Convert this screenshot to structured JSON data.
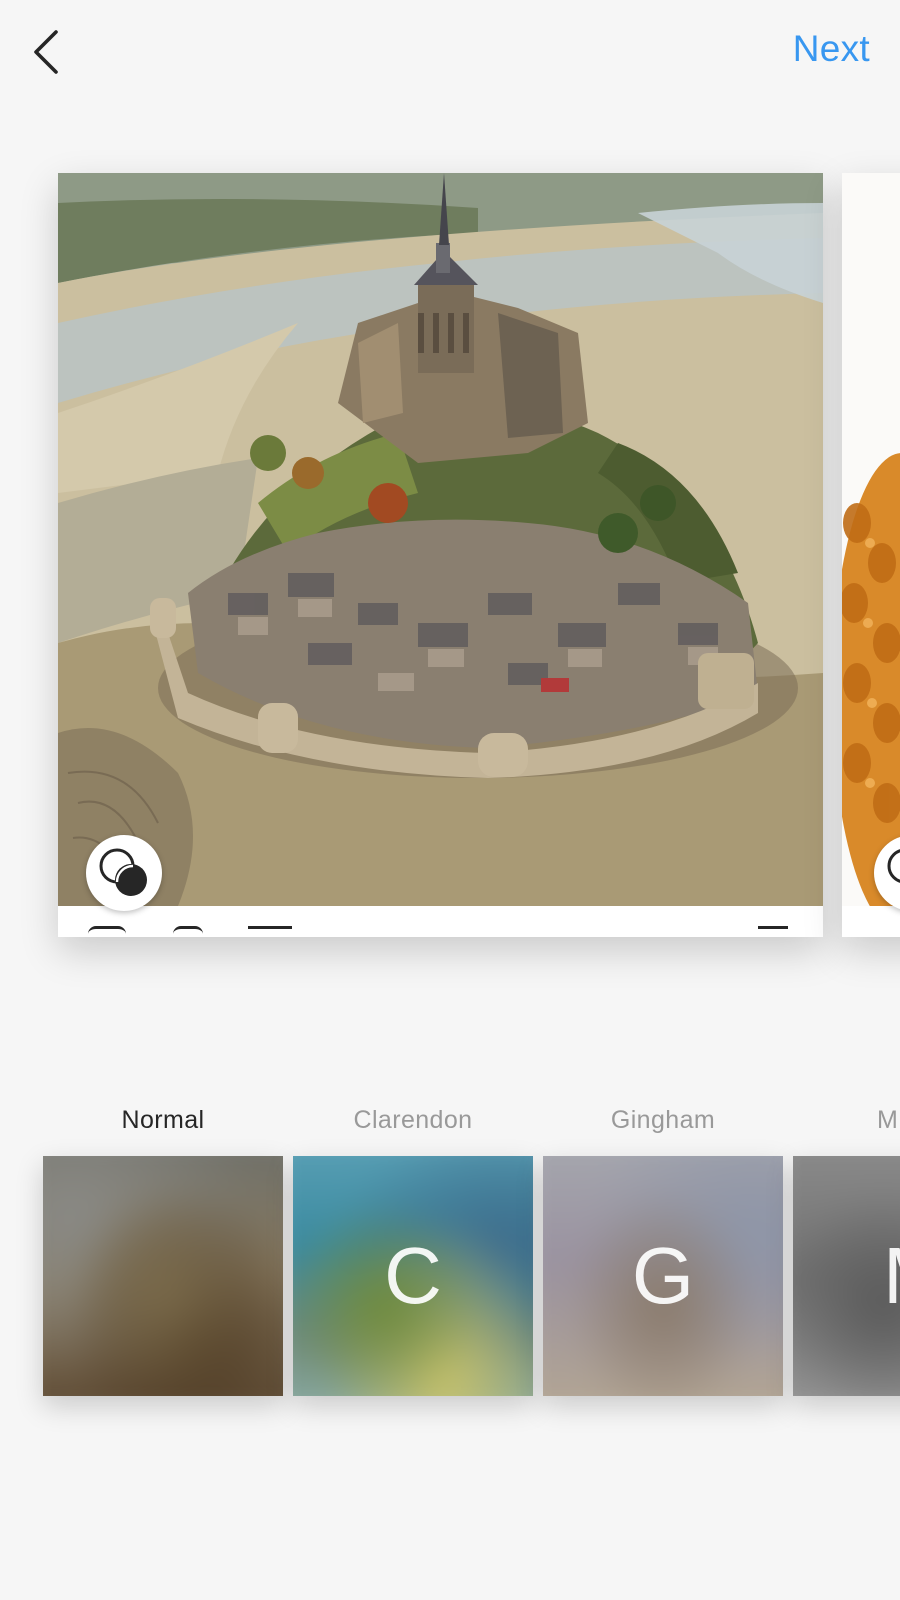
{
  "header": {
    "next_label": "Next"
  },
  "icons": {
    "back": "chevron-left-icon",
    "blend": "overlapping-circles-icon"
  },
  "colors": {
    "accent": "#3897f0",
    "background": "#f6f6f6",
    "selected_text": "#262626",
    "muted_text": "#999999"
  },
  "filters": [
    {
      "label": "Normal",
      "letter": "",
      "selected": true
    },
    {
      "label": "Clarendon",
      "letter": "C",
      "selected": false
    },
    {
      "label": "Gingham",
      "letter": "G",
      "selected": false
    },
    {
      "label": "M",
      "letter": "M",
      "selected": false
    }
  ]
}
